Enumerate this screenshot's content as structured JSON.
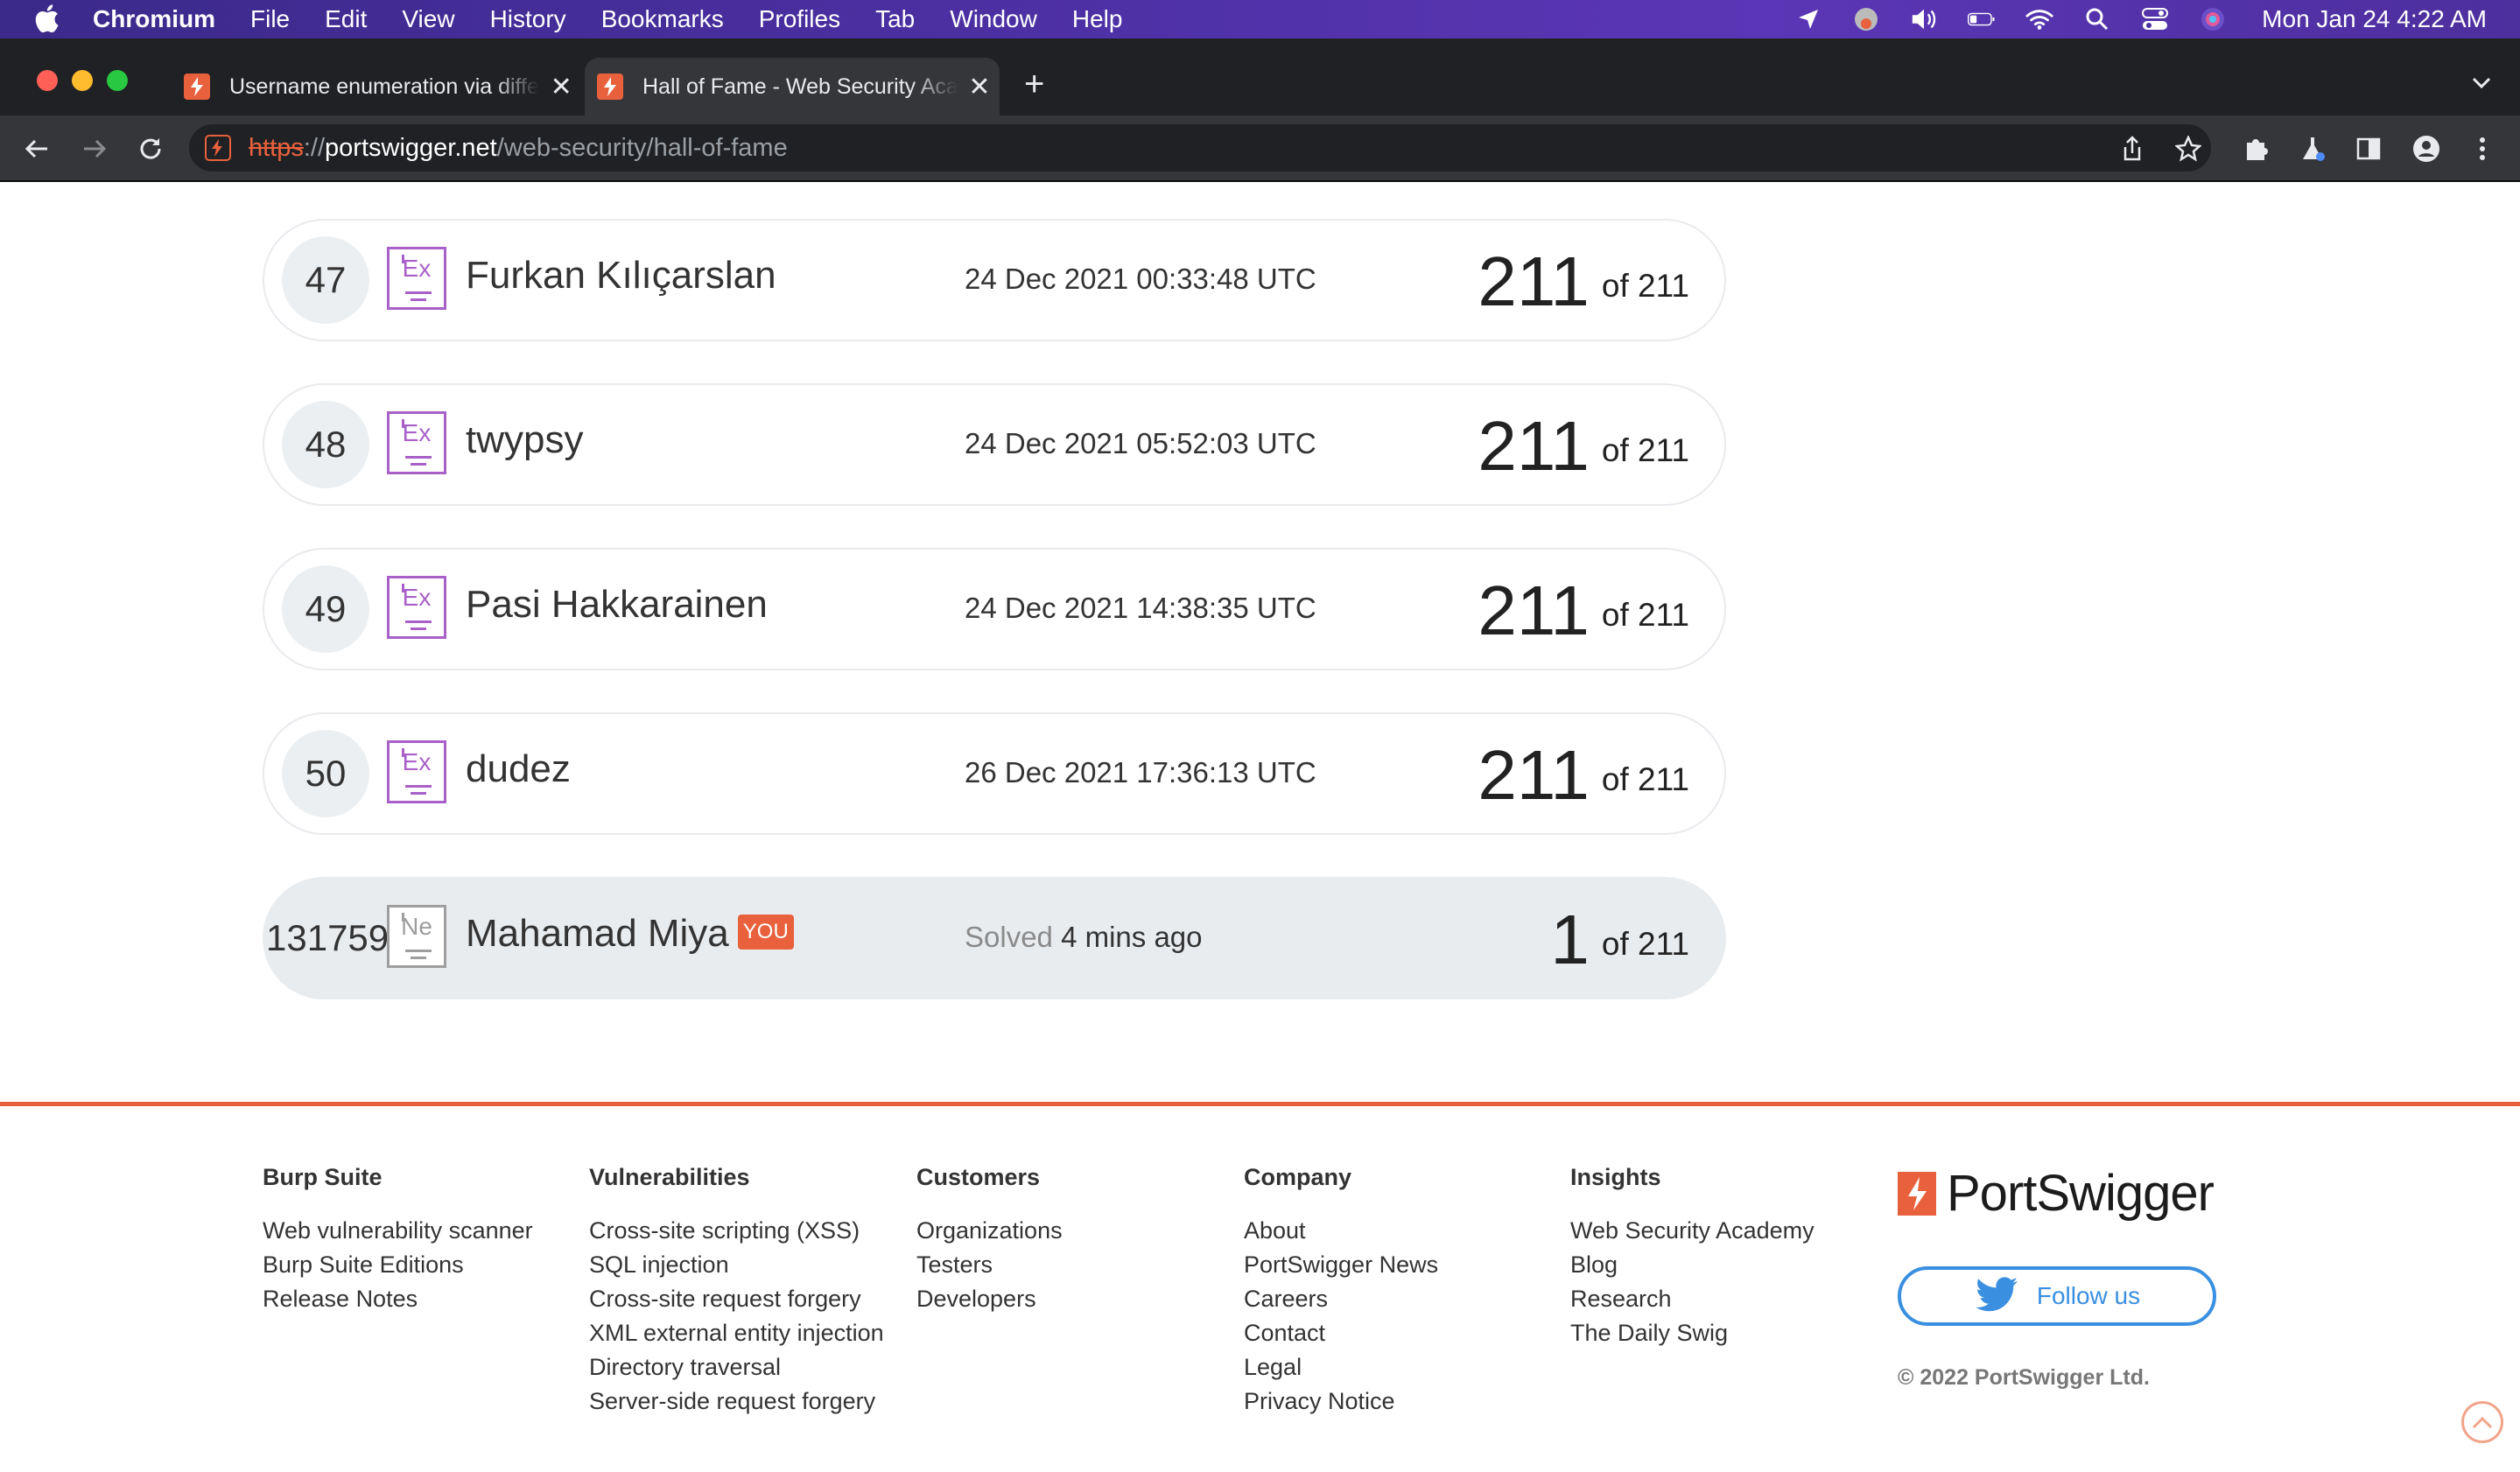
{
  "menubar": {
    "app": "Chromium",
    "menus": [
      "File",
      "Edit",
      "View",
      "History",
      "Bookmarks",
      "Profiles",
      "Tab",
      "Window",
      "Help"
    ],
    "clock": "Mon Jan 24  4:22 AM"
  },
  "tabs": [
    {
      "title": "Username enumeration via different responses",
      "active": false
    },
    {
      "title": "Hall of Fame - Web Security Academy",
      "active": true
    }
  ],
  "address": {
    "scheme": "https",
    "separator": "://",
    "host": "portswigger.net",
    "path": "/web-security/hall-of-fame"
  },
  "leaderboard": [
    {
      "rank": "47",
      "badge": "Ex",
      "name": "Furkan Kılıçarslan",
      "date": "24 Dec 2021 00:33:48 UTC",
      "solved": "211",
      "of": "of 211"
    },
    {
      "rank": "48",
      "badge": "Ex",
      "name": "twypsy",
      "date": "24 Dec 2021 05:52:03 UTC",
      "solved": "211",
      "of": "of 211"
    },
    {
      "rank": "49",
      "badge": "Ex",
      "name": "Pasi Hakkarainen",
      "date": "24 Dec 2021 14:38:35 UTC",
      "solved": "211",
      "of": "of 211"
    },
    {
      "rank": "50",
      "badge": "Ex",
      "name": "dudez",
      "date": "26 Dec 2021 17:36:13 UTC",
      "solved": "211",
      "of": "of 211"
    }
  ],
  "current_user": {
    "rank": "131759",
    "badge": "Ne",
    "name": "Mahamad Miya",
    "you_tag": "YOU",
    "solved_label": "Solved",
    "solved_when": "4 mins ago",
    "solved": "1",
    "of": "of 211"
  },
  "footer": {
    "columns": [
      {
        "heading": "Burp Suite",
        "links": [
          "Web vulnerability scanner",
          "Burp Suite Editions",
          "Release Notes"
        ]
      },
      {
        "heading": "Vulnerabilities",
        "links": [
          "Cross-site scripting (XSS)",
          "SQL injection",
          "Cross-site request forgery",
          "XML external entity injection",
          "Directory traversal",
          "Server-side request forgery"
        ]
      },
      {
        "heading": "Customers",
        "links": [
          "Organizations",
          "Testers",
          "Developers"
        ]
      },
      {
        "heading": "Company",
        "links": [
          "About",
          "PortSwigger News",
          "Careers",
          "Contact",
          "Legal",
          "Privacy Notice"
        ]
      },
      {
        "heading": "Insights",
        "links": [
          "Web Security Academy",
          "Blog",
          "Research",
          "The Daily Swig"
        ]
      }
    ],
    "brand": "PortSwigger",
    "follow_label": "Follow us",
    "copyright": "© 2022 PortSwigger Ltd."
  },
  "colors": {
    "accent": "#e8613c",
    "expert_badge": "#a960c8",
    "novice_badge": "#9e9e9e",
    "twitter": "#3a8fe0"
  }
}
